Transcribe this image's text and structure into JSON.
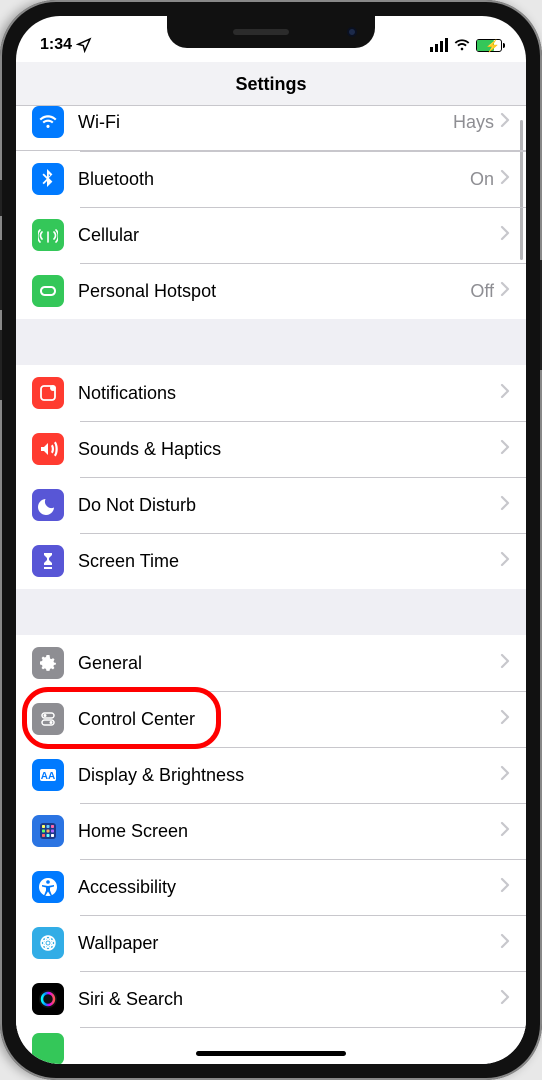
{
  "status": {
    "time": "1:34",
    "battery_pct": 70,
    "charging": true
  },
  "header": {
    "title": "Settings"
  },
  "highlight": {
    "row_index": 8
  },
  "rows": [
    {
      "icon": "wifi-icon",
      "bg": "bg-blue",
      "label": "Wi-Fi",
      "value": "Hays",
      "partial": true
    },
    {
      "icon": "bluetooth-icon",
      "bg": "bg-blue",
      "label": "Bluetooth",
      "value": "On"
    },
    {
      "icon": "cellular-icon",
      "bg": "bg-green",
      "label": "Cellular",
      "value": ""
    },
    {
      "icon": "hotspot-icon",
      "bg": "bg-green",
      "label": "Personal Hotspot",
      "value": "Off"
    },
    {
      "sep": true
    },
    {
      "icon": "notifications-icon",
      "bg": "bg-red",
      "label": "Notifications",
      "value": ""
    },
    {
      "icon": "sounds-icon",
      "bg": "bg-red",
      "label": "Sounds & Haptics",
      "value": ""
    },
    {
      "icon": "dnd-icon",
      "bg": "bg-purple",
      "label": "Do Not Disturb",
      "value": ""
    },
    {
      "icon": "screentime-icon",
      "bg": "bg-purple",
      "label": "Screen Time",
      "value": ""
    },
    {
      "sep": true
    },
    {
      "icon": "general-icon",
      "bg": "bg-gray",
      "label": "General",
      "value": ""
    },
    {
      "icon": "controlcenter-icon",
      "bg": "bg-gray",
      "label": "Control Center",
      "value": ""
    },
    {
      "icon": "display-icon",
      "bg": "bg-blue",
      "label": "Display & Brightness",
      "value": ""
    },
    {
      "icon": "homescreen-icon",
      "bg": "bg-blue3",
      "label": "Home Screen",
      "value": ""
    },
    {
      "icon": "accessibility-icon",
      "bg": "bg-blue",
      "label": "Accessibility",
      "value": ""
    },
    {
      "icon": "wallpaper-icon",
      "bg": "bg-cyan",
      "label": "Wallpaper",
      "value": ""
    },
    {
      "icon": "siri-icon",
      "bg": "bg-black",
      "label": "Siri & Search",
      "value": ""
    },
    {
      "icon": "next-partial",
      "bg": "bg-green",
      "label": "",
      "value": "",
      "peek": true
    }
  ]
}
